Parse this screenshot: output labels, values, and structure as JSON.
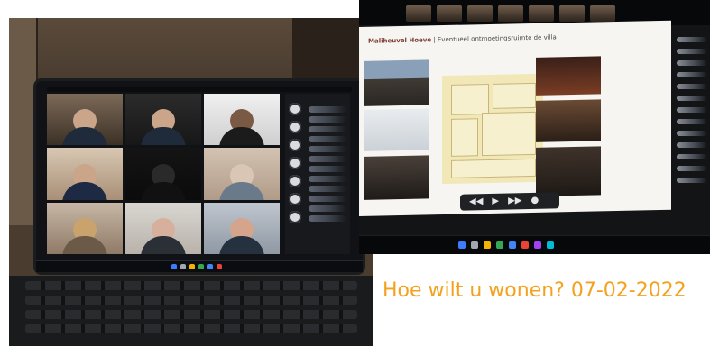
{
  "caption": {
    "text": "Hoe wilt u wonen? 07-02-2022"
  },
  "slide": {
    "title_bold": "Maliheuvel Hoeve",
    "title_rest": " | Eventueel ontmoetingsruimte de villa"
  },
  "media_controls": {
    "prev": "◀◀",
    "play": "▶",
    "next": "▶▶",
    "more": "●"
  },
  "right_taskbar": {
    "time": ""
  },
  "colors": {
    "caption": "#f4a21e"
  }
}
